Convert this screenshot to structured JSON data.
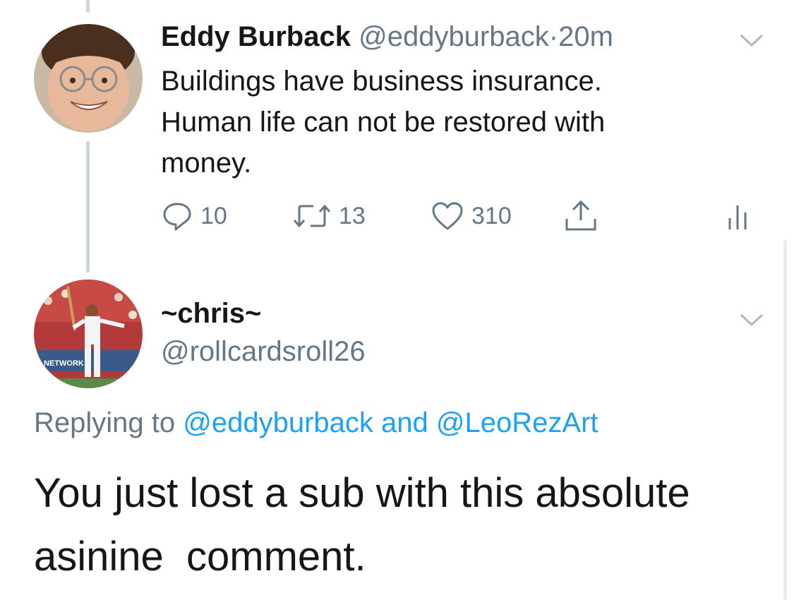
{
  "tweet": {
    "author_name": "Eddy Burback",
    "author_handle": "@eddyburback",
    "separator": "·",
    "time": "20m",
    "text_lines": [
      "Buildings have business insurance.",
      "Human life can not be restored with",
      "money."
    ],
    "actions": {
      "replies": "10",
      "retweets": "13",
      "likes": "310"
    },
    "menu_icon": "chevron-down-icon"
  },
  "reply": {
    "author_name": "~chris~",
    "author_handle": "@rollcardsroll26",
    "replying_prefix": "Replying to",
    "replying_handle_1": "@eddyburback",
    "replying_joiner": "and",
    "replying_handle_2": "@LeoRezArt",
    "text_lines": [
      "You just lost a sub with this absolute",
      "asinine  comment."
    ],
    "avatar_caption": "NETWORK",
    "menu_icon": "chevron-down-icon"
  },
  "icons": {
    "reply": "speech-bubble-icon",
    "retweet": "retweet-icon",
    "like": "heart-icon",
    "share": "share-icon",
    "stats": "analytics-icon"
  },
  "colors": {
    "text": "#14171a",
    "secondary": "#657786",
    "link": "#1da1f2",
    "thread_line": "#ccd6dd"
  }
}
